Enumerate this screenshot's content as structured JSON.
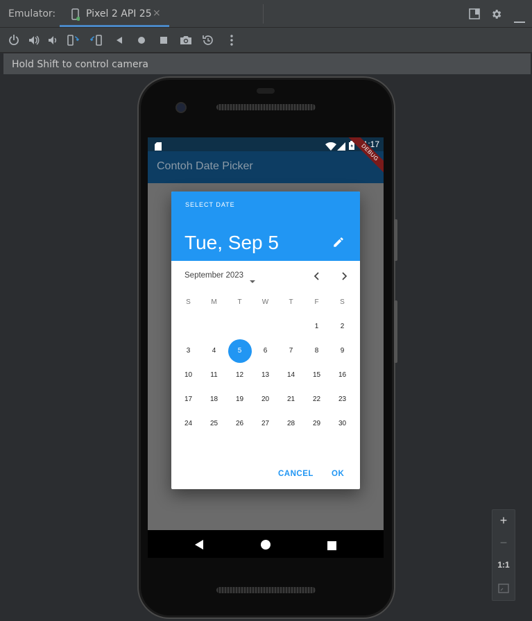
{
  "window": {
    "panel_label": "Emulator:",
    "device_tab": "Pixel 2 API 25",
    "tab_close": "×"
  },
  "toolbar_icons": [
    "power-icon",
    "volume-up-icon",
    "volume-down-icon",
    "rotate-left-icon",
    "rotate-right-icon",
    "back-icon",
    "home-icon",
    "overview-icon",
    "camera-icon",
    "snapshot-icon",
    "more-icon"
  ],
  "hint": "Hold Shift to control camera",
  "app": {
    "title": "Contoh Date Picker",
    "time": "11:17",
    "debug_banner": "DEBUG"
  },
  "picker": {
    "help_text": "SELECT DATE",
    "header_date": "Tue, Sep 5",
    "month_year": "September 2023",
    "weekdays": [
      "S",
      "M",
      "T",
      "W",
      "T",
      "F",
      "S"
    ],
    "weeks": [
      [
        "",
        "",
        "",
        "",
        "",
        "1",
        "2"
      ],
      [
        "3",
        "4",
        "5",
        "6",
        "7",
        "8",
        "9"
      ],
      [
        "10",
        "11",
        "12",
        "13",
        "14",
        "15",
        "16"
      ],
      [
        "17",
        "18",
        "19",
        "20",
        "21",
        "22",
        "23"
      ],
      [
        "24",
        "25",
        "26",
        "27",
        "28",
        "29",
        "30"
      ]
    ],
    "selected_day": "5",
    "cancel_label": "CANCEL",
    "ok_label": "OK",
    "accent": "#2196f3"
  },
  "zoom": {
    "plus": "+",
    "minus": "−",
    "one_to_one": "1:1"
  }
}
